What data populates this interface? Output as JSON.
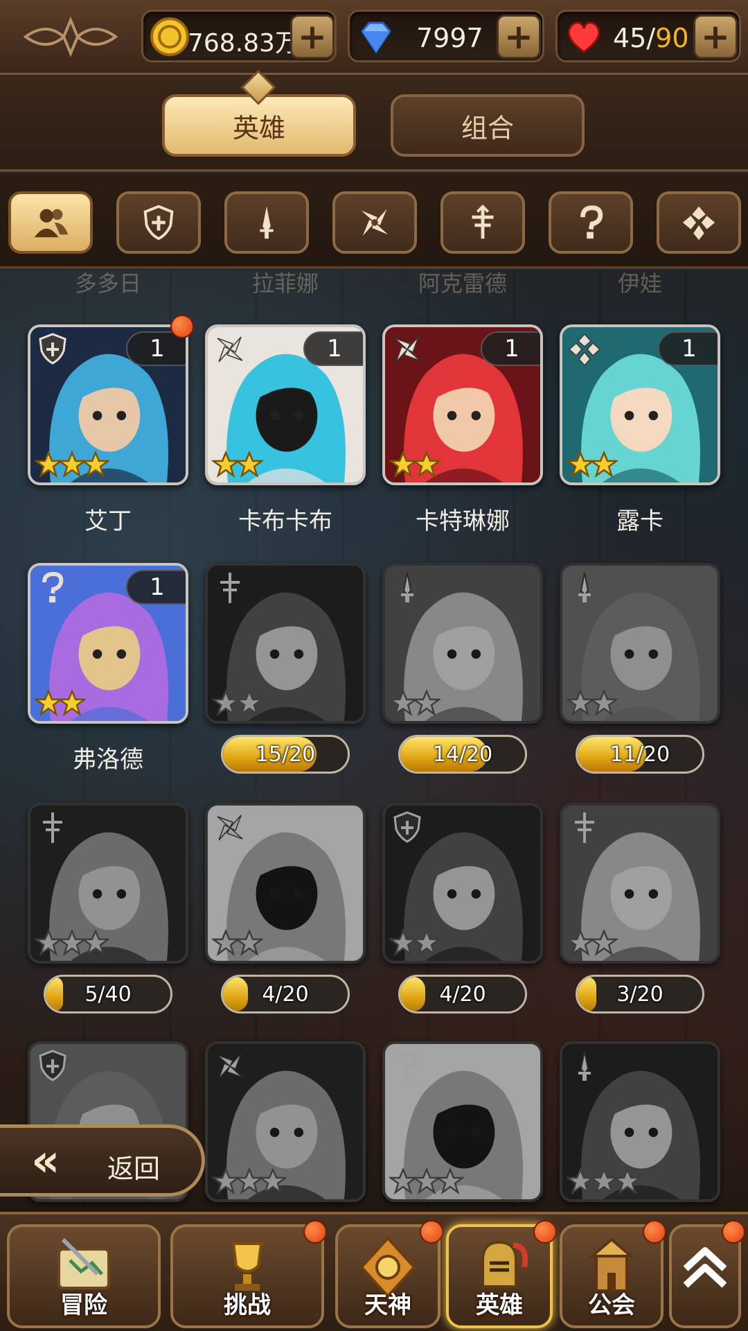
{
  "currency": {
    "gold": {
      "value": "768.83万",
      "icon": "gold-coin-icon"
    },
    "diamonds": {
      "value": "7997",
      "icon": "diamond-icon"
    },
    "stamina": {
      "current": "45",
      "separator": "/",
      "max": "90",
      "icon": "heart-icon",
      "max_color": "#f2b81c"
    },
    "add_label": "+"
  },
  "tabs": [
    {
      "label": "英雄",
      "active": true
    },
    {
      "label": "组合",
      "active": false
    }
  ],
  "filters": [
    {
      "icon": "all-heroes-icon",
      "active": true
    },
    {
      "icon": "shield-class-icon",
      "active": false
    },
    {
      "icon": "sword-class-icon",
      "active": false
    },
    {
      "icon": "shuriken-class-icon",
      "active": false
    },
    {
      "icon": "cross-staff-class-icon",
      "active": false
    },
    {
      "icon": "question-class-icon",
      "active": false
    },
    {
      "icon": "clover-class-icon",
      "active": false
    }
  ],
  "ghost_names": [
    "多多日",
    "拉菲娜",
    "阿克雷德",
    "伊娃"
  ],
  "owned_heroes": [
    {
      "name": "艾丁",
      "count": "1",
      "stars": 3,
      "class_icon": "shield-class-icon",
      "red_dot": true
    },
    {
      "name": "卡布卡布",
      "count": "1",
      "stars": 2,
      "class_icon": "shuriken-class-icon",
      "red_dot": false
    },
    {
      "name": "卡特琳娜",
      "count": "1",
      "stars": 2,
      "class_icon": "shuriken-class-icon",
      "red_dot": false
    },
    {
      "name": "露卡",
      "count": "1",
      "stars": 2,
      "class_icon": "clover-class-icon",
      "red_dot": false
    },
    {
      "name": "弗洛德",
      "count": "1",
      "stars": 2,
      "class_icon": "question-class-icon",
      "red_dot": false
    }
  ],
  "locked_heroes": [
    {
      "stars": 2,
      "class_icon": "cross-staff-class-icon",
      "progress": "15/20",
      "fraction": 0.75
    },
    {
      "stars": 2,
      "class_icon": "sword-class-icon",
      "progress": "14/20",
      "fraction": 0.7
    },
    {
      "stars": 2,
      "class_icon": "sword-class-icon",
      "progress": "11/20",
      "fraction": 0.55
    },
    {
      "stars": 3,
      "class_icon": "cross-staff-class-icon",
      "progress": "5/40",
      "fraction": 0.125
    },
    {
      "stars": 2,
      "class_icon": "shuriken-class-icon",
      "progress": "4/20",
      "fraction": 0.2
    },
    {
      "stars": 2,
      "class_icon": "shield-class-icon",
      "progress": "4/20",
      "fraction": 0.2
    },
    {
      "stars": 2,
      "class_icon": "cross-staff-class-icon",
      "progress": "3/20",
      "fraction": 0.15
    },
    {
      "stars": 3,
      "class_icon": "shield-class-icon",
      "progress": null,
      "fraction": null
    },
    {
      "stars": 3,
      "class_icon": "shuriken-class-icon",
      "progress": null,
      "fraction": null
    },
    {
      "stars": 3,
      "class_icon": "question-class-icon",
      "progress": null,
      "fraction": null
    },
    {
      "stars": 3,
      "class_icon": "sword-class-icon",
      "progress": null,
      "fraction": null
    }
  ],
  "back_button": {
    "label": "返回",
    "icon": "back-chevron-icon"
  },
  "bottom_nav": [
    {
      "label": "冒险",
      "icon": "map-scroll-icon",
      "red_dot": false,
      "active": false
    },
    {
      "label": "挑战",
      "icon": "trophy-icon",
      "red_dot": true,
      "active": false
    },
    {
      "label": "天神",
      "icon": "deity-emblem-icon",
      "red_dot": true,
      "active": false
    },
    {
      "label": "英雄",
      "icon": "knight-helmet-icon",
      "red_dot": true,
      "active": true
    },
    {
      "label": "公会",
      "icon": "guild-tower-icon",
      "red_dot": true,
      "active": false
    },
    {
      "label": "",
      "icon": "double-chevron-up-icon",
      "red_dot": true,
      "active": false
    }
  ],
  "colors": {
    "accent_gold": "#f2c34d",
    "red_dot": "#e0400e",
    "panel_brown": "#3a2619"
  }
}
